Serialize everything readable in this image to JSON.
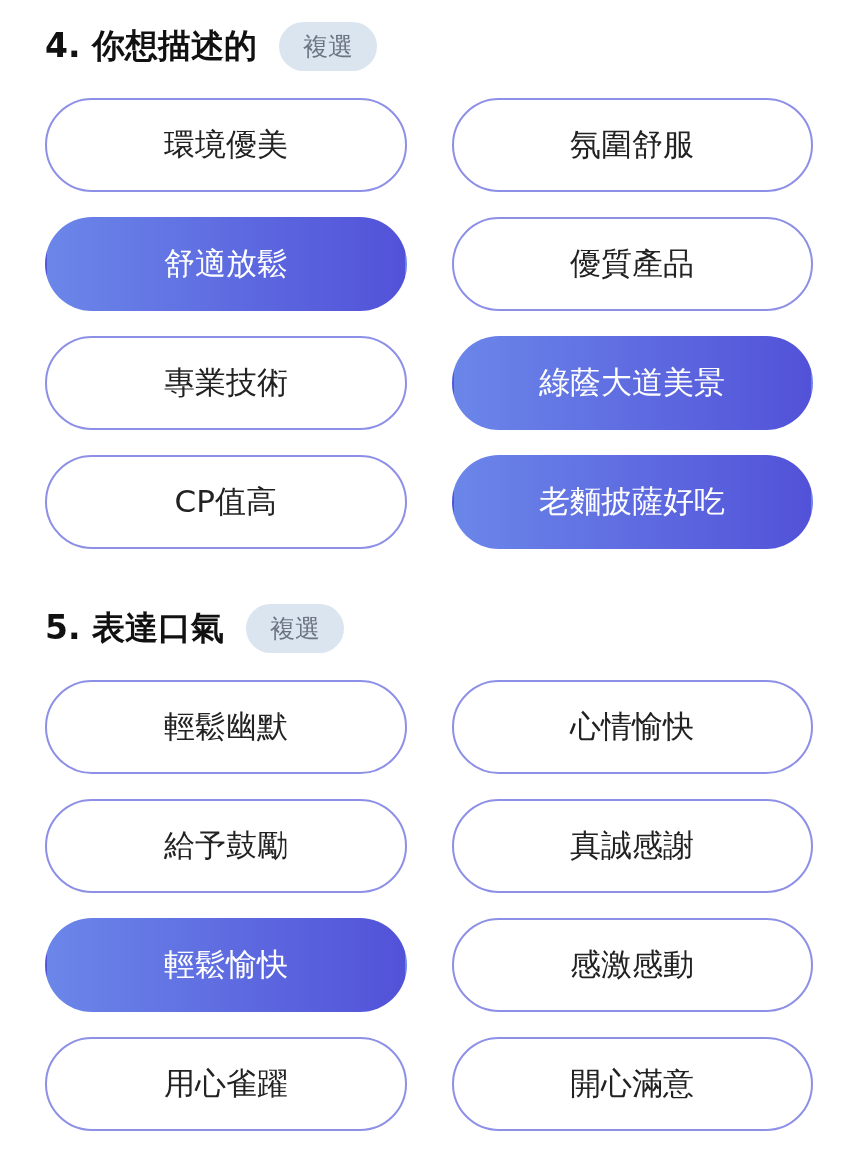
{
  "sections": [
    {
      "title": "4. 你想描述的",
      "badge": "複選",
      "options": [
        {
          "label": "環境優美",
          "selected": false
        },
        {
          "label": "氛圍舒服",
          "selected": false
        },
        {
          "label": "舒適放鬆",
          "selected": true
        },
        {
          "label": "優質產品",
          "selected": false
        },
        {
          "label": "專業技術",
          "selected": false
        },
        {
          "label": "綠蔭大道美景",
          "selected": true
        },
        {
          "label": "CP值高",
          "selected": false
        },
        {
          "label": "老麵披薩好吃",
          "selected": true
        }
      ]
    },
    {
      "title": "5. 表達口氣",
      "badge": "複選",
      "options": [
        {
          "label": "輕鬆幽默",
          "selected": false
        },
        {
          "label": "心情愉快",
          "selected": false
        },
        {
          "label": "給予鼓勵",
          "selected": false
        },
        {
          "label": "真誠感謝",
          "selected": false
        },
        {
          "label": "輕鬆愉快",
          "selected": true
        },
        {
          "label": "感激感動",
          "selected": false
        },
        {
          "label": "用心雀躍",
          "selected": false
        },
        {
          "label": "開心滿意",
          "selected": false
        }
      ]
    }
  ]
}
